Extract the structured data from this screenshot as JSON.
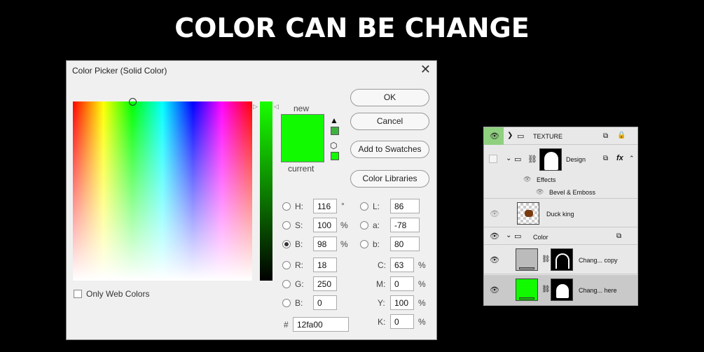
{
  "headline": "COLOR CAN BE CHANGE",
  "dialog": {
    "title": "Color Picker (Solid Color)",
    "close_glyph": "✕",
    "new_label": "new",
    "current_label": "current",
    "new_color": "#12fa00",
    "buttons": {
      "ok": "OK",
      "cancel": "Cancel",
      "add_to_swatches": "Add to Swatches",
      "color_libraries": "Color Libraries"
    },
    "fields": {
      "h": {
        "label": "H:",
        "value": "116",
        "unit": "°"
      },
      "s": {
        "label": "S:",
        "value": "100",
        "unit": "%"
      },
      "b": {
        "label": "B:",
        "value": "98",
        "unit": "%"
      },
      "r": {
        "label": "R:",
        "value": "18"
      },
      "g": {
        "label": "G:",
        "value": "250"
      },
      "b2": {
        "label": "B:",
        "value": "0"
      },
      "l": {
        "label": "L:",
        "value": "86"
      },
      "a": {
        "label": "a:",
        "value": "-78"
      },
      "lab_b": {
        "label": "b:",
        "value": "80"
      },
      "c": {
        "label": "C:",
        "value": "63",
        "unit": "%"
      },
      "m": {
        "label": "M:",
        "value": "0",
        "unit": "%"
      },
      "y": {
        "label": "Y:",
        "value": "100",
        "unit": "%"
      },
      "k": {
        "label": "K:",
        "value": "0",
        "unit": "%"
      },
      "hex": {
        "label": "#",
        "value": "12fa00"
      }
    },
    "only_web_colors": "Only Web Colors",
    "icons": {
      "warning": "warning-icon",
      "cube": "cube-icon"
    }
  },
  "layers": {
    "rows": [
      {
        "name": "TEXTURE"
      },
      {
        "name": "Design"
      },
      {
        "name": "Effects"
      },
      {
        "name": "Bevel & Emboss"
      },
      {
        "name": "Duck king"
      },
      {
        "name": "Color"
      },
      {
        "name": "Chang... copy"
      },
      {
        "name": "Chang... here"
      }
    ],
    "fx_label": "fx",
    "colors": {
      "selected_row": "#c9c9c9",
      "texture_eye_bg": "#8fd07f",
      "green_fill": "#12fa00"
    }
  }
}
